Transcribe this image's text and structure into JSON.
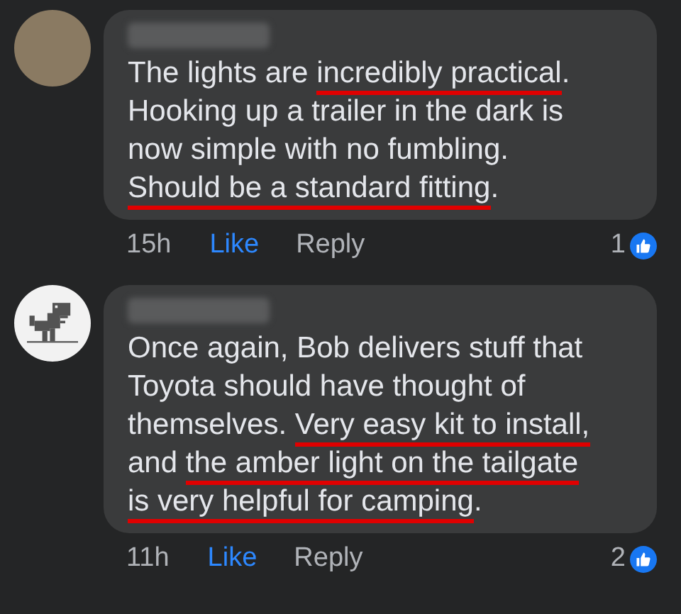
{
  "comments": [
    {
      "avatar": {
        "kind": "photo"
      },
      "lines": [
        [
          {
            "text": "The lights are ",
            "underlined": false
          },
          {
            "text": "incredibly practical",
            "underlined": true
          },
          {
            "text": ".",
            "underlined": false
          }
        ],
        [
          {
            "text": "Hooking up a trailer in the dark is",
            "underlined": false
          }
        ],
        [
          {
            "text": "now simple with no fumbling.",
            "underlined": false
          }
        ],
        [
          {
            "text": "Should be a standard fitting",
            "underlined": true
          },
          {
            "text": ".",
            "underlined": false
          }
        ]
      ],
      "time": "15h",
      "like": "Like",
      "reply": "Reply",
      "reactions": "1"
    },
    {
      "avatar": {
        "kind": "dino"
      },
      "lines": [
        [
          {
            "text": "Once again, Bob delivers stuff that",
            "underlined": false
          }
        ],
        [
          {
            "text": "Toyota should have thought of",
            "underlined": false
          }
        ],
        [
          {
            "text": "themselves. ",
            "underlined": false
          },
          {
            "text": "Very easy kit to install,",
            "underlined": true
          }
        ],
        [
          {
            "text": "and ",
            "underlined": false
          },
          {
            "text": "the amber light on the tailgate",
            "underlined": true
          }
        ],
        [
          {
            "text": "is very helpful for camping",
            "underlined": true
          },
          {
            "text": ".",
            "underlined": false
          }
        ]
      ],
      "time": "11h",
      "like": "Like",
      "reply": "Reply",
      "reactions": "2"
    }
  ]
}
